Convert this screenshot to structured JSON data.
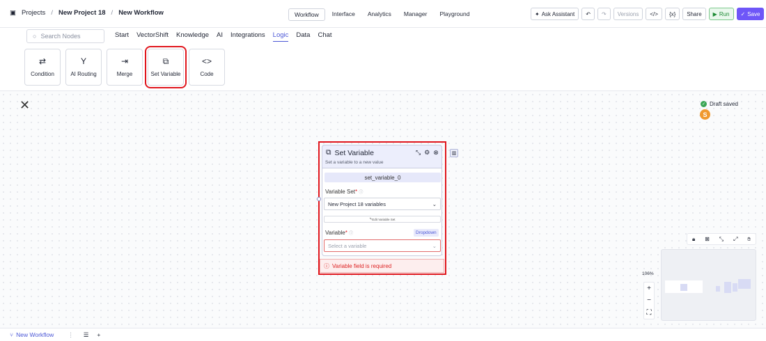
{
  "breadcrumb": {
    "projects": "Projects",
    "sep": "/",
    "project": "New Project 18",
    "workflow": "New Workflow"
  },
  "top_tabs": [
    "Workflow",
    "Interface",
    "Analytics",
    "Manager",
    "Playground"
  ],
  "actions": {
    "assistant": "Ask Assistant",
    "versions": "Versions",
    "share": "Share",
    "run": "Run",
    "save": "Save"
  },
  "search": {
    "placeholder": "Search Nodes"
  },
  "categories": [
    "Start",
    "VectorShift",
    "Knowledge",
    "AI",
    "Integrations",
    "Logic",
    "Data",
    "Chat"
  ],
  "active_category": "Logic",
  "node_types": [
    {
      "label": "Condition",
      "icon": "⇄"
    },
    {
      "label": "AI Routing",
      "icon": "Y"
    },
    {
      "label": "Merge",
      "icon": "⇥"
    },
    {
      "label": "Set Variable",
      "icon": "⧉"
    },
    {
      "label": "Code",
      "icon": "<>"
    }
  ],
  "status": {
    "draft": "Draft saved",
    "avatar": "S"
  },
  "node": {
    "title": "Set Variable",
    "subtitle": "Set a variable to a new value",
    "name": "set_variable_0",
    "variable_set_label": "Variable Set",
    "variable_set_value": "New Project 18 variables",
    "edit_label": "Edit Variable Set",
    "variable_label": "Variable",
    "dropdown_badge": "Dropdown",
    "variable_placeholder": "Select a variable",
    "error": "Variable field is required"
  },
  "zoom": "106%",
  "bottom": {
    "workflow_tab": "New Workflow"
  },
  "colors": {
    "accent": "#4a56d6",
    "highlight": "#e0151c",
    "save": "#6e56f8"
  }
}
